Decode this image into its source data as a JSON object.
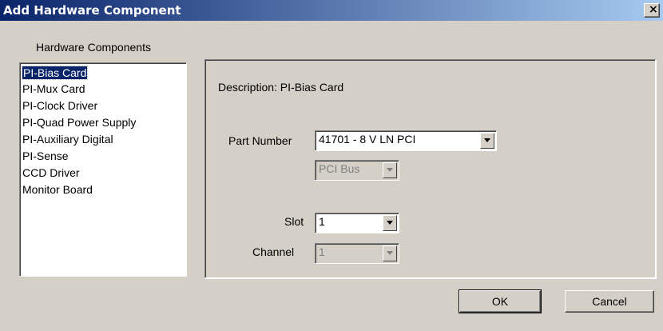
{
  "window": {
    "title": "Add Hardware Component",
    "close_glyph": "×"
  },
  "components": {
    "label": "Hardware Components",
    "items": [
      "PI-Bias Card",
      "PI-Mux Card",
      "PI-Clock Driver",
      "PI-Quad Power Supply",
      "PI-Auxiliary Digital",
      "PI-Sense",
      "CCD Driver",
      "Monitor Board"
    ],
    "selected": "PI-Bias Card"
  },
  "details": {
    "description": "Description:  PI-Bias Card",
    "part_number_label": "Part Number",
    "part_number_value": "41701 - 8 V LN PCI",
    "bus_value": "PCI Bus",
    "slot_label": "Slot",
    "slot_value": "1",
    "channel_label": "Channel",
    "channel_value": "1"
  },
  "buttons": {
    "ok": "OK",
    "cancel": "Cancel"
  },
  "colors": {
    "titlebar_start": "#0a246a",
    "titlebar_end": "#a6caf0",
    "face": "#d4d0c8",
    "selection": "#0a246a"
  }
}
